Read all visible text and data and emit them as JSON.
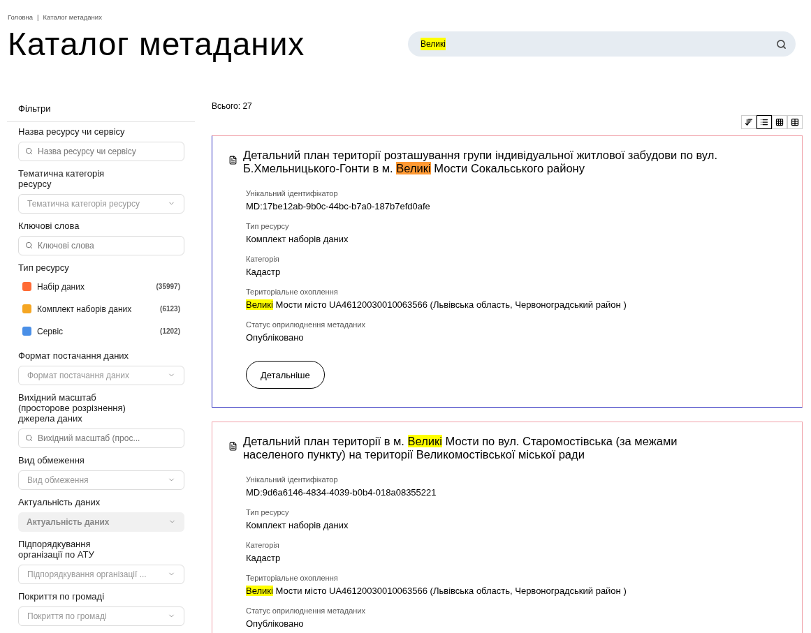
{
  "breadcrumbs": [
    "Головна",
    "|",
    "Каталог метаданих"
  ],
  "title": "Каталог метаданих",
  "search": {
    "value": "Великі"
  },
  "filters": {
    "heading": "Фільтри",
    "groups": [
      {
        "kind": "search",
        "label": "Назва ресурсу чи сервісу",
        "placeholder": "Назва ресурсу чи сервісу"
      },
      {
        "kind": "select",
        "label": "Тематична категорія ресурсу",
        "placeholder": "Тематична категорія ресурсу",
        "disabled": false
      },
      {
        "kind": "search",
        "label": "Ключові слова",
        "placeholder": "Ключові слова"
      },
      {
        "kind": "types",
        "label": "Тип ресурсу",
        "items": [
          {
            "label": "Набір даних",
            "count": "(35997)",
            "color": "#ff6b35"
          },
          {
            "label": "Комплект наборів даних",
            "count": "(6123)",
            "color": "#f5a623"
          },
          {
            "label": "Сервіс",
            "count": "(1202)",
            "color": "#4a8fe7"
          }
        ]
      },
      {
        "kind": "select",
        "label": "Формат постачання даних",
        "placeholder": "Формат постачання даних",
        "disabled": false
      },
      {
        "kind": "search",
        "label": "Вихідний масштаб (просторове розрізнення) джерела даних",
        "placeholder": "Вихідний масштаб (прос..."
      },
      {
        "kind": "select",
        "label": "Вид обмеження",
        "placeholder": "Вид обмеження",
        "disabled": false
      },
      {
        "kind": "select",
        "label": "Актуальність даних",
        "placeholder": "Актуальність даних",
        "disabled": true
      },
      {
        "kind": "select",
        "label": "Підпорядкування організації по АТУ",
        "placeholder": "Підпорядкування організації ...",
        "disabled": false
      },
      {
        "kind": "select",
        "label": "Покриття по громаді",
        "placeholder": "Покриття по громаді",
        "disabled": false
      }
    ]
  },
  "total": "Всього: 27",
  "view_buttons": [
    {
      "kind": "sort",
      "selected": false
    },
    {
      "kind": "list",
      "selected": true
    },
    {
      "kind": "grid",
      "selected": false
    },
    {
      "kind": "table",
      "selected": false
    }
  ],
  "results": [
    {
      "focused": true,
      "title": [
        {
          "text": "Детальний план території розташування групи індивідуальної житлової забудови по вул. Б.Хмельницького-Гонти в м. ",
          "highlighted": false,
          "current": false
        },
        {
          "text": "Великі",
          "highlighted": true,
          "current": true
        },
        {
          "text": " Мости Сокальського району",
          "highlighted": false,
          "current": false
        }
      ],
      "fields": [
        {
          "label": "Унікальний ідентифікатор",
          "value": [
            {
              "text": "MD:17be12ab-9b0c-44bc-b7a0-187b7efd0afe",
              "highlighted": false,
              "current": false
            }
          ]
        },
        {
          "label": "Тип ресурсу",
          "value": [
            {
              "text": "Комплект наборів даних",
              "highlighted": false,
              "current": false
            }
          ]
        },
        {
          "label": "Категорія",
          "value": [
            {
              "text": "Кадастр",
              "highlighted": false,
              "current": false
            }
          ]
        },
        {
          "label": "Територіальне охоплення",
          "value": [
            {
              "text": "Великі",
              "highlighted": true,
              "current": false
            },
            {
              "text": " Мости місто UA46120030010063566 (Львівська область, Червоноградський район )",
              "highlighted": false,
              "current": false
            }
          ]
        },
        {
          "label": "Статус оприлюднення метаданих",
          "value": [
            {
              "text": "Опубліковано",
              "highlighted": false,
              "current": false
            }
          ]
        }
      ],
      "button": "Детальніше"
    },
    {
      "focused": false,
      "title": [
        {
          "text": "Детальний план території в м. ",
          "highlighted": false,
          "current": false
        },
        {
          "text": "Великі",
          "highlighted": true,
          "current": false
        },
        {
          "text": " Мости по вул. Старомостівська (за межами населеного пункту) на території Великомостівської міської ради",
          "highlighted": false,
          "current": false
        }
      ],
      "fields": [
        {
          "label": "Унікальний ідентифікатор",
          "value": [
            {
              "text": "MD:9d6a6146-4834-4039-b0b4-018a08355221",
              "highlighted": false,
              "current": false
            }
          ]
        },
        {
          "label": "Тип ресурсу",
          "value": [
            {
              "text": "Комплект наборів даних",
              "highlighted": false,
              "current": false
            }
          ]
        },
        {
          "label": "Категорія",
          "value": [
            {
              "text": "Кадастр",
              "highlighted": false,
              "current": false
            }
          ]
        },
        {
          "label": "Територіальне охоплення",
          "value": [
            {
              "text": "Великі",
              "highlighted": true,
              "current": false
            },
            {
              "text": " Мости місто UA46120030010063566 (Львівська область, Червоноградський район )",
              "highlighted": false,
              "current": false
            }
          ]
        },
        {
          "label": "Статус оприлюднення метаданих",
          "value": [
            {
              "text": "Опубліковано",
              "highlighted": false,
              "current": false
            }
          ]
        }
      ]
    }
  ]
}
